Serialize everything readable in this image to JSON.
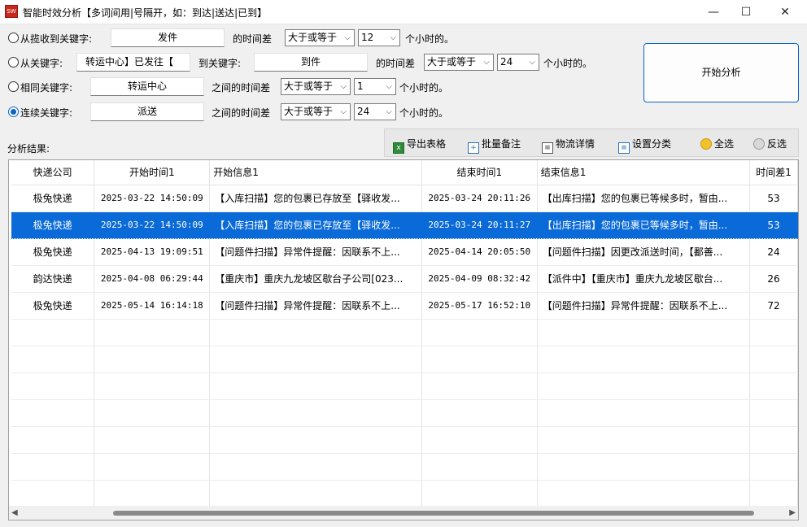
{
  "window": {
    "title": "智能时效分析【多词间用|号隔开，如：到达|送达|已到】",
    "icon_text": "SW",
    "minimize": "—",
    "maximize": "☐",
    "close": "✕"
  },
  "options": [
    {
      "label": "从揽收到关键字:",
      "keyword": "发件",
      "diff_label": "的时间差",
      "operator": "大于或等于",
      "hours": "12",
      "unit": "个小时的。",
      "checked": false
    },
    {
      "label": "从关键字:",
      "keyword": "转运中心】已发往【",
      "to_label": "到关键字:",
      "to_keyword": "到件",
      "diff_label": "的时间差",
      "operator": "大于或等于",
      "hours": "24",
      "unit": "个小时的。",
      "checked": false
    },
    {
      "label": "相同关键字:",
      "keyword": "转运中心",
      "diff_label": "之间的时间差",
      "operator": "大于或等于",
      "hours": "1",
      "unit": "个小时的。",
      "checked": false
    },
    {
      "label": "连续关键字:",
      "keyword": "派送",
      "diff_label": "之间的时间差",
      "operator": "大于或等于",
      "hours": "24",
      "unit": "个小时的。",
      "checked": true
    }
  ],
  "analyze_button": "开始分析",
  "result_label": "分析结果:",
  "toolbar": {
    "export": "导出表格",
    "batch_note": "批量备注",
    "logistics_detail": "物流详情",
    "set_category": "设置分类",
    "select_all": "全选",
    "invert": "反选"
  },
  "table": {
    "columns": [
      "快递公司",
      "开始时间1",
      "开始信息1",
      "结束时间1",
      "结束信息1",
      "时间差1"
    ],
    "rows": [
      [
        "极兔快递",
        "2025-03-22 14:50:09",
        "【入库扫描】您的包裹已存放至【驿收发...",
        "2025-03-24 20:11:26",
        "【出库扫描】您的包裹已等候多时，暂由...",
        "53"
      ],
      [
        "极兔快递",
        "2025-03-22 14:50:09",
        "【入库扫描】您的包裹已存放至【驿收发...",
        "2025-03-24 20:11:27",
        "【出库扫描】您的包裹已等候多时，暂由...",
        "53"
      ],
      [
        "极兔快递",
        "2025-04-13 19:09:51",
        "【问题件扫描】异常件提醒：因联系不上...",
        "2025-04-14 20:05:50",
        "【问题件扫描】因更改派送时间，【鄱善...",
        "24"
      ],
      [
        "韵达快递",
        "2025-04-08 06:29:44",
        "【重庆市】重庆九龙坡区歇台子公司[023...",
        "2025-04-09 08:32:42",
        "【派件中】【重庆市】重庆九龙坡区歇台...",
        "26"
      ],
      [
        "极兔快递",
        "2025-05-14 16:14:18",
        "【问题件扫描】异常件提醒：因联系不上...",
        "2025-05-17 16:52:10",
        "【问题件扫描】异常件提醒：因联系不上...",
        "72"
      ]
    ],
    "selected_row": 1,
    "empty_rows": 7
  },
  "scroll": {
    "left": "◀",
    "right": "▶"
  },
  "colors": {
    "accent": "#0a64c8",
    "selection": "#0a6ad8"
  }
}
